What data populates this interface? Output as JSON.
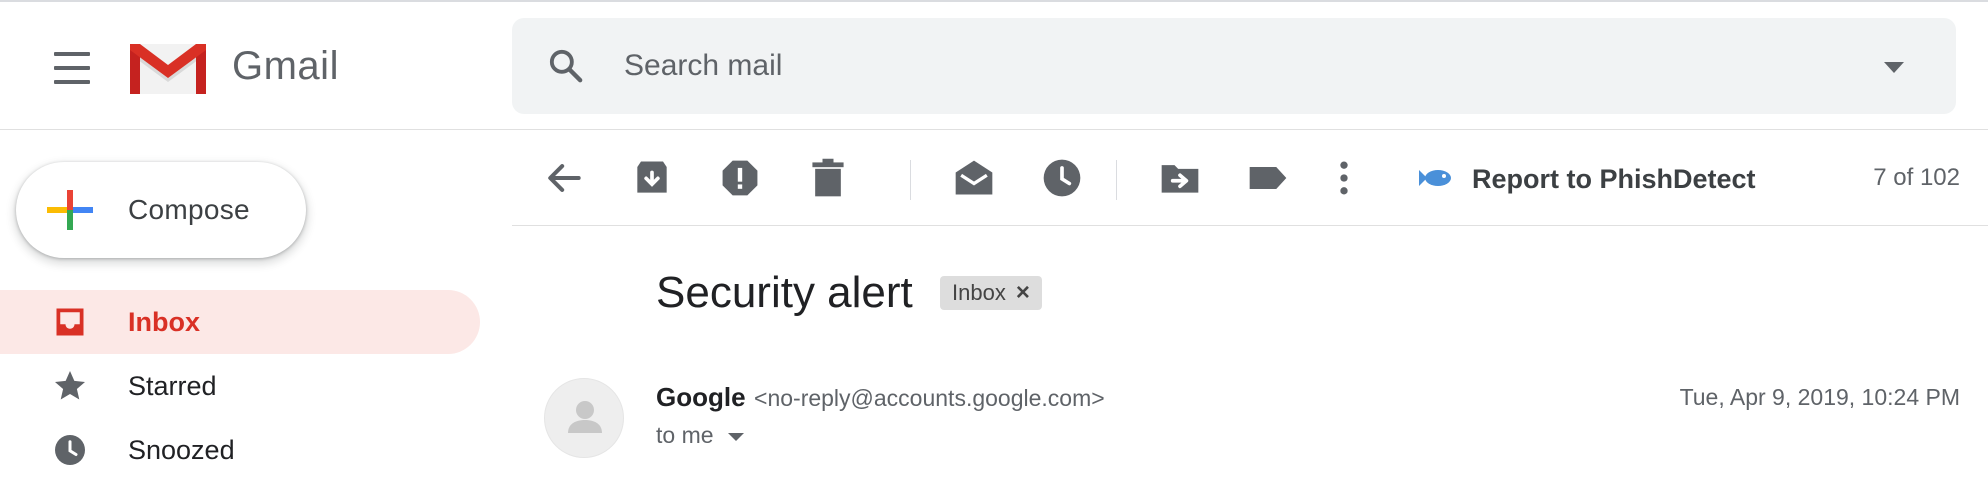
{
  "header": {
    "app_name": "Gmail",
    "search": {
      "placeholder": "Search mail",
      "value": ""
    }
  },
  "sidebar": {
    "compose_label": "Compose",
    "items": [
      {
        "label": "Inbox",
        "icon": "inbox-icon",
        "active": true
      },
      {
        "label": "Starred",
        "icon": "star-icon",
        "active": false
      },
      {
        "label": "Snoozed",
        "icon": "clock-icon",
        "active": false
      }
    ]
  },
  "toolbar": {
    "actions": [
      "back",
      "archive",
      "report-spam",
      "delete",
      "mark-unread",
      "snooze",
      "move-to",
      "labels",
      "more"
    ],
    "phish_label": "Report to PhishDetect",
    "pager": "7 of 102"
  },
  "message": {
    "subject": "Security alert",
    "label_chip": "Inbox",
    "label_chip_remove": "×",
    "sender_name": "Google",
    "sender_email": "<no-reply@accounts.google.com>",
    "to": "to me",
    "date": "Tue, Apr 9, 2019, 10:24 PM"
  },
  "colors": {
    "accent_red": "#d93025",
    "active_bg": "#fce8e6",
    "search_bg": "#f1f3f4",
    "icon_gray": "#5f6368",
    "phish_blue": "#4a90d9"
  }
}
